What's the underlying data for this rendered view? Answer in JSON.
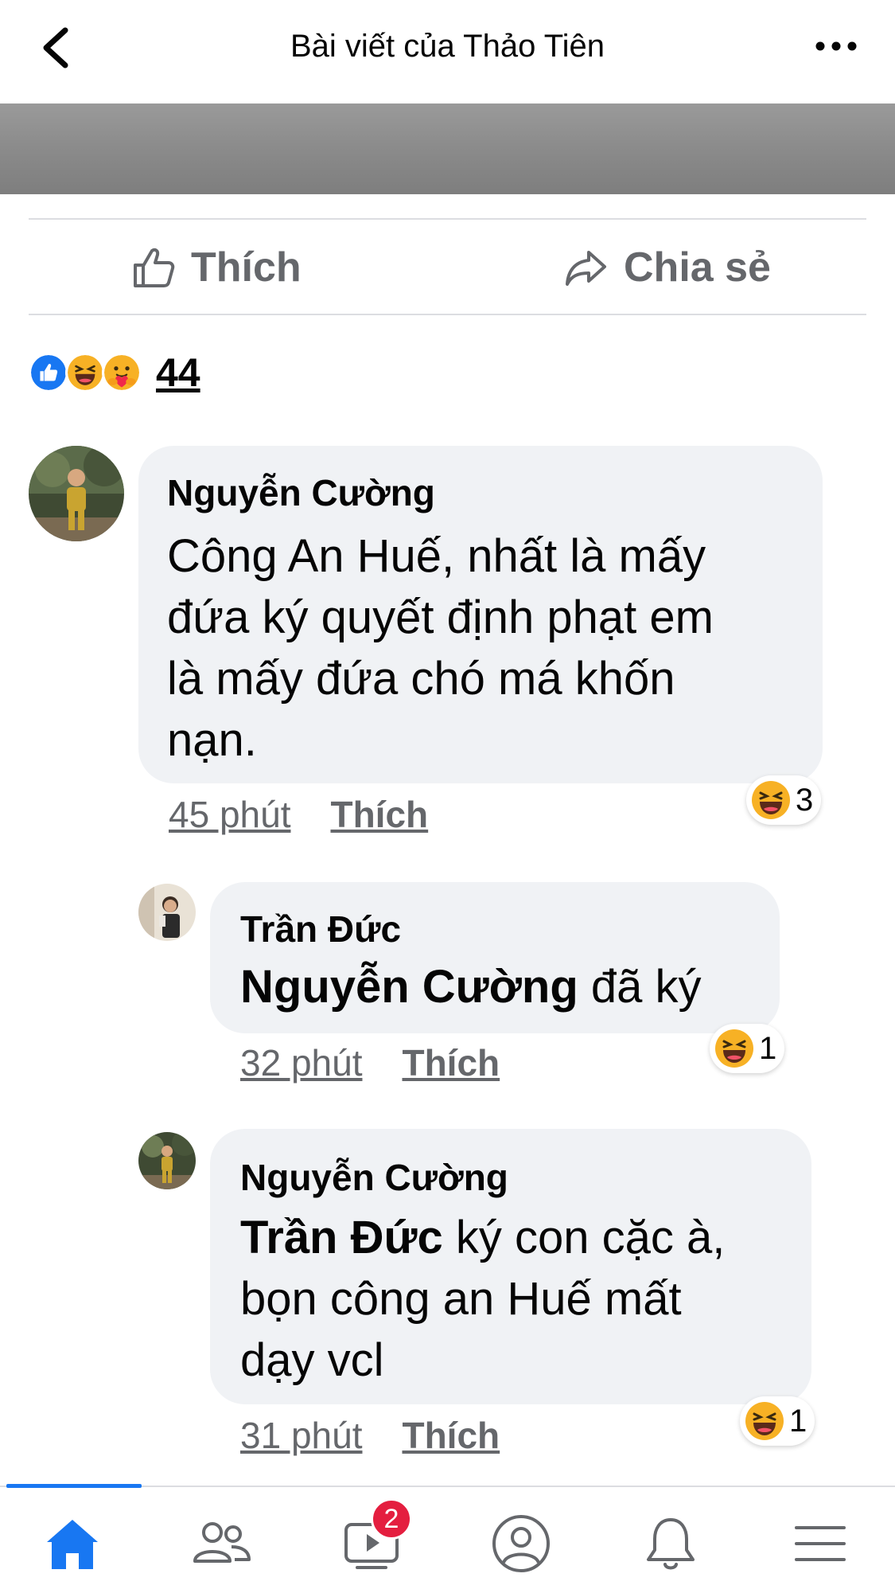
{
  "header": {
    "title": "Bài viết của Thảo Tiên",
    "back_icon": "chevron-left-icon",
    "more_icon": "more-dots-icon"
  },
  "actions": {
    "like_label": "Thích",
    "share_label": "Chia sẻ"
  },
  "reactions_summary": {
    "count": "44",
    "types": [
      "like",
      "haha",
      "care"
    ]
  },
  "comments": [
    {
      "author": "Nguyễn Cường",
      "text_lines": [
        "Công An Huế, nhất là mấy",
        "đứa ký quyết định phạt em",
        "là mấy đứa chó má khốn",
        "nạn."
      ],
      "time": "45 phút",
      "like_label": "Thích",
      "reaction_count": "3"
    },
    {
      "author": "Trần Đức",
      "mention": "Nguyễn Cường",
      "text": "đã ký",
      "time": "32 phút",
      "like_label": "Thích",
      "reaction_count": "1"
    },
    {
      "author": "Nguyễn Cường",
      "mention": "Trần Đức",
      "text_first": "ký con cặc à,",
      "text_lines": [
        "bọn công an Huế mất",
        "dạy vcl"
      ],
      "time": "31 phút",
      "like_label": "Thích",
      "reaction_count": "1"
    }
  ],
  "bottom_nav": {
    "items": [
      "home-icon",
      "friends-icon",
      "watch-icon",
      "profile-icon",
      "notifications-icon",
      "menu-icon"
    ],
    "watch_badge": "2",
    "accent": "#1877f2"
  }
}
